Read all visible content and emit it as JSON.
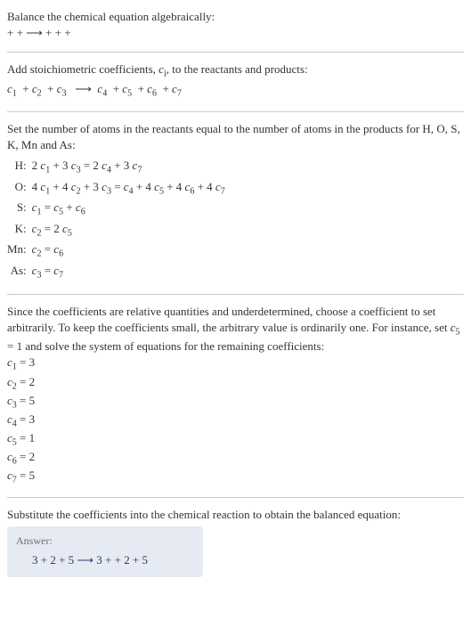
{
  "intro": {
    "line1": "Balance the chemical equation algebraically:",
    "line2": " +  +   ⟶   +  +  + "
  },
  "stoich": {
    "line1": "Add stoichiometric coefficients, cᵢ, to the reactants and products:",
    "line2": "c₁  + c₂  + c₃   ⟶  c₄  + c₅  + c₆  + c₇"
  },
  "atoms": {
    "intro": "Set the number of atoms in the reactants equal to the number of atoms in the products for H, O, S, K, Mn and As:",
    "rows": [
      {
        "label": "H:",
        "eq": "2 c₁ + 3 c₃ = 2 c₄ + 3 c₇"
      },
      {
        "label": "O:",
        "eq": "4 c₁ + 4 c₂ + 3 c₃ = c₄ + 4 c₅ + 4 c₆ + 4 c₇"
      },
      {
        "label": "S:",
        "eq": "c₁ = c₅ + c₆"
      },
      {
        "label": "K:",
        "eq": "c₂ = 2 c₅"
      },
      {
        "label": "Mn:",
        "eq": "c₂ = c₆"
      },
      {
        "label": "As:",
        "eq": "c₃ = c₇"
      }
    ]
  },
  "solve": {
    "intro": "Since the coefficients are relative quantities and underdetermined, choose a coefficient to set arbitrarily. To keep the coefficients small, the arbitrary value is ordinarily one. For instance, set c₅ = 1 and solve the system of equations for the remaining coefficients:",
    "coeffs": [
      "c₁ = 3",
      "c₂ = 2",
      "c₃ = 5",
      "c₄ = 3",
      "c₅ = 1",
      "c₆ = 2",
      "c₇ = 5"
    ]
  },
  "subst": {
    "intro": "Substitute the coefficients into the chemical reaction to obtain the balanced equation:"
  },
  "answer": {
    "label": "Answer:",
    "eq": "3  + 2  + 5   ⟶  3  +  + 2  + 5"
  }
}
